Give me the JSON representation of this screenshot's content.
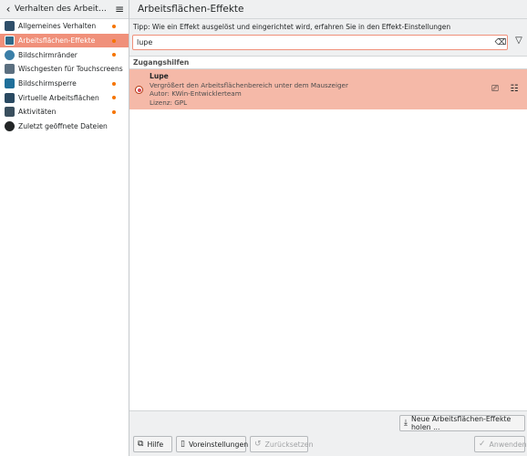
{
  "sidebar": {
    "back_icon": "chevron-left-icon",
    "title": "Verhalten des Arbeitsber...",
    "menu_icon": "hamburger-menu-icon",
    "items": [
      {
        "label": "Allgemeines Verhalten",
        "icon": "general-behavior-icon",
        "dot": true
      },
      {
        "label": "Arbeitsflächen-Effekte",
        "icon": "desktop-effects-icon",
        "dot": true
      },
      {
        "label": "Bildschirmränder",
        "icon": "screen-edges-icon",
        "dot": true
      },
      {
        "label": "Wischgesten für Touchscreens",
        "icon": "touch-gestures-icon",
        "dot": false
      },
      {
        "label": "Bildschirmsperre",
        "icon": "screen-lock-icon",
        "dot": true
      },
      {
        "label": "Virtuelle Arbeitsflächen",
        "icon": "virtual-desktops-icon",
        "dot": true
      },
      {
        "label": "Aktivitäten",
        "icon": "activities-icon",
        "dot": true
      },
      {
        "label": "Zuletzt geöffnete Dateien",
        "icon": "recent-files-icon",
        "dot": false
      }
    ]
  },
  "main": {
    "title": "Arbeitsflächen-Effekte",
    "tip": "Tipp: Wie ein Effekt ausgelöst und eingerichtet wird, erfahren Sie in den Effekt-Einstellungen",
    "search_value": "lupe",
    "group": "Zugangshilfen",
    "effect": {
      "name": "Lupe",
      "description": "Vergrößert den Arbeitsflächenbereich unter dem Mauszeiger",
      "author": "Autor: KWin-Entwicklerteam",
      "license": "Lizenz: GPL"
    }
  },
  "buttons": {
    "get_new": "Neue Arbeitsflächen-Effekte holen ...",
    "help": "Hilfe",
    "defaults": "Voreinstellungen",
    "reset": "Zurücksetzen",
    "apply": "Anwenden"
  },
  "colors": {
    "accent": "#f0907a",
    "selected_row": "#f5b9a8",
    "dot": "#f67400"
  }
}
